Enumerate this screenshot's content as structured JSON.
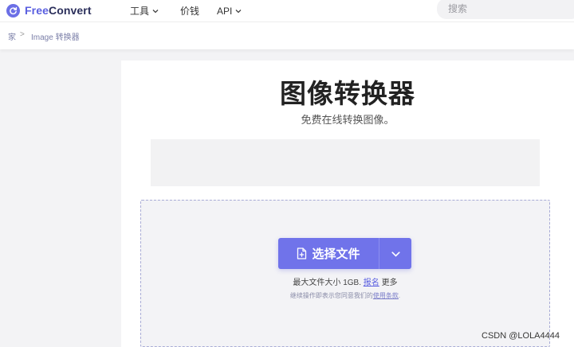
{
  "header": {
    "logo": {
      "free": "Free",
      "convert": "Convert",
      "icon": "refresh-logo-icon",
      "brand_color": "#5a5fe0"
    },
    "nav": [
      {
        "label": "工具",
        "has_dropdown": true
      },
      {
        "label": "价钱",
        "has_dropdown": false
      },
      {
        "label": "API",
        "has_dropdown": true
      }
    ],
    "search": {
      "placeholder": "搜索"
    }
  },
  "breadcrumb": {
    "home": "家",
    "separator": ">",
    "current": "Image 转换器"
  },
  "main": {
    "title": "图像转换器",
    "subtitle": "免费在线转换图像。",
    "upload": {
      "button_label": "选择文件",
      "button_color": "#7073ea",
      "limit_text": "最大文件大小 1GB.",
      "signup_link": "报名",
      "more_text": "更多",
      "terms_prefix": "继续操作即表示您同意我们的",
      "terms_link": "使用条款",
      "terms_suffix": "."
    }
  },
  "watermark": "CSDN @LOLA4444"
}
